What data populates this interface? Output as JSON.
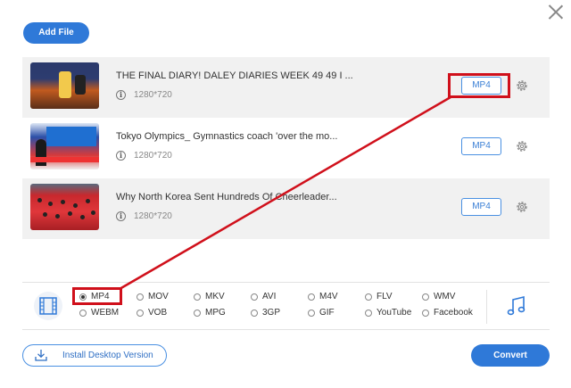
{
  "toolbar": {
    "add_file_label": "Add File"
  },
  "files": [
    {
      "title": "THE FINAL DIARY! DALEY DIARIES WEEK 49 49 I ...",
      "resolution": "1280*720",
      "format": "MP4"
    },
    {
      "title": "Tokyo Olympics_ Gymnastics coach 'over the mo...",
      "resolution": "1280*720",
      "format": "MP4"
    },
    {
      "title": "Why North Korea Sent Hundreds Of Cheerleader...",
      "resolution": "1280*720",
      "format": "MP4"
    }
  ],
  "formats": {
    "selected": "MP4",
    "options": [
      "MP4",
      "MOV",
      "MKV",
      "AVI",
      "M4V",
      "FLV",
      "WMV",
      "WEBM",
      "VOB",
      "MPG",
      "3GP",
      "GIF",
      "YouTube",
      "Facebook"
    ]
  },
  "footer": {
    "install_label": "Install Desktop Version",
    "convert_label": "Convert"
  },
  "colors": {
    "accent": "#2f79d8",
    "highlight": "#d0101b"
  },
  "icons": {
    "close": "close-icon",
    "info": "info-icon",
    "settings": "gear-icon",
    "video": "film-icon",
    "audio": "music-note-icon",
    "download": "download-icon"
  }
}
